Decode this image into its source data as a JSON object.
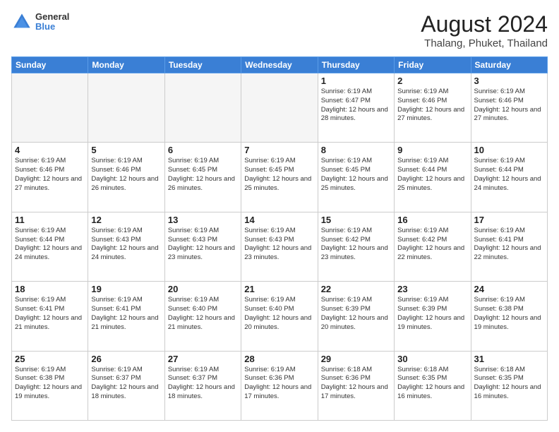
{
  "header": {
    "logo_line1": "General",
    "logo_line2": "Blue",
    "month_year": "August 2024",
    "location": "Thalang, Phuket, Thailand"
  },
  "weekdays": [
    "Sunday",
    "Monday",
    "Tuesday",
    "Wednesday",
    "Thursday",
    "Friday",
    "Saturday"
  ],
  "weeks": [
    [
      {
        "day": "",
        "info": ""
      },
      {
        "day": "",
        "info": ""
      },
      {
        "day": "",
        "info": ""
      },
      {
        "day": "",
        "info": ""
      },
      {
        "day": "1",
        "info": "Sunrise: 6:19 AM\nSunset: 6:47 PM\nDaylight: 12 hours\nand 28 minutes."
      },
      {
        "day": "2",
        "info": "Sunrise: 6:19 AM\nSunset: 6:46 PM\nDaylight: 12 hours\nand 27 minutes."
      },
      {
        "day": "3",
        "info": "Sunrise: 6:19 AM\nSunset: 6:46 PM\nDaylight: 12 hours\nand 27 minutes."
      }
    ],
    [
      {
        "day": "4",
        "info": "Sunrise: 6:19 AM\nSunset: 6:46 PM\nDaylight: 12 hours\nand 27 minutes."
      },
      {
        "day": "5",
        "info": "Sunrise: 6:19 AM\nSunset: 6:46 PM\nDaylight: 12 hours\nand 26 minutes."
      },
      {
        "day": "6",
        "info": "Sunrise: 6:19 AM\nSunset: 6:45 PM\nDaylight: 12 hours\nand 26 minutes."
      },
      {
        "day": "7",
        "info": "Sunrise: 6:19 AM\nSunset: 6:45 PM\nDaylight: 12 hours\nand 25 minutes."
      },
      {
        "day": "8",
        "info": "Sunrise: 6:19 AM\nSunset: 6:45 PM\nDaylight: 12 hours\nand 25 minutes."
      },
      {
        "day": "9",
        "info": "Sunrise: 6:19 AM\nSunset: 6:44 PM\nDaylight: 12 hours\nand 25 minutes."
      },
      {
        "day": "10",
        "info": "Sunrise: 6:19 AM\nSunset: 6:44 PM\nDaylight: 12 hours\nand 24 minutes."
      }
    ],
    [
      {
        "day": "11",
        "info": "Sunrise: 6:19 AM\nSunset: 6:44 PM\nDaylight: 12 hours\nand 24 minutes."
      },
      {
        "day": "12",
        "info": "Sunrise: 6:19 AM\nSunset: 6:43 PM\nDaylight: 12 hours\nand 24 minutes."
      },
      {
        "day": "13",
        "info": "Sunrise: 6:19 AM\nSunset: 6:43 PM\nDaylight: 12 hours\nand 23 minutes."
      },
      {
        "day": "14",
        "info": "Sunrise: 6:19 AM\nSunset: 6:43 PM\nDaylight: 12 hours\nand 23 minutes."
      },
      {
        "day": "15",
        "info": "Sunrise: 6:19 AM\nSunset: 6:42 PM\nDaylight: 12 hours\nand 23 minutes."
      },
      {
        "day": "16",
        "info": "Sunrise: 6:19 AM\nSunset: 6:42 PM\nDaylight: 12 hours\nand 22 minutes."
      },
      {
        "day": "17",
        "info": "Sunrise: 6:19 AM\nSunset: 6:41 PM\nDaylight: 12 hours\nand 22 minutes."
      }
    ],
    [
      {
        "day": "18",
        "info": "Sunrise: 6:19 AM\nSunset: 6:41 PM\nDaylight: 12 hours\nand 21 minutes."
      },
      {
        "day": "19",
        "info": "Sunrise: 6:19 AM\nSunset: 6:41 PM\nDaylight: 12 hours\nand 21 minutes."
      },
      {
        "day": "20",
        "info": "Sunrise: 6:19 AM\nSunset: 6:40 PM\nDaylight: 12 hours\nand 21 minutes."
      },
      {
        "day": "21",
        "info": "Sunrise: 6:19 AM\nSunset: 6:40 PM\nDaylight: 12 hours\nand 20 minutes."
      },
      {
        "day": "22",
        "info": "Sunrise: 6:19 AM\nSunset: 6:39 PM\nDaylight: 12 hours\nand 20 minutes."
      },
      {
        "day": "23",
        "info": "Sunrise: 6:19 AM\nSunset: 6:39 PM\nDaylight: 12 hours\nand 19 minutes."
      },
      {
        "day": "24",
        "info": "Sunrise: 6:19 AM\nSunset: 6:38 PM\nDaylight: 12 hours\nand 19 minutes."
      }
    ],
    [
      {
        "day": "25",
        "info": "Sunrise: 6:19 AM\nSunset: 6:38 PM\nDaylight: 12 hours\nand 19 minutes."
      },
      {
        "day": "26",
        "info": "Sunrise: 6:19 AM\nSunset: 6:37 PM\nDaylight: 12 hours\nand 18 minutes."
      },
      {
        "day": "27",
        "info": "Sunrise: 6:19 AM\nSunset: 6:37 PM\nDaylight: 12 hours\nand 18 minutes."
      },
      {
        "day": "28",
        "info": "Sunrise: 6:19 AM\nSunset: 6:36 PM\nDaylight: 12 hours\nand 17 minutes."
      },
      {
        "day": "29",
        "info": "Sunrise: 6:18 AM\nSunset: 6:36 PM\nDaylight: 12 hours\nand 17 minutes."
      },
      {
        "day": "30",
        "info": "Sunrise: 6:18 AM\nSunset: 6:35 PM\nDaylight: 12 hours\nand 16 minutes."
      },
      {
        "day": "31",
        "info": "Sunrise: 6:18 AM\nSunset: 6:35 PM\nDaylight: 12 hours\nand 16 minutes."
      }
    ]
  ]
}
